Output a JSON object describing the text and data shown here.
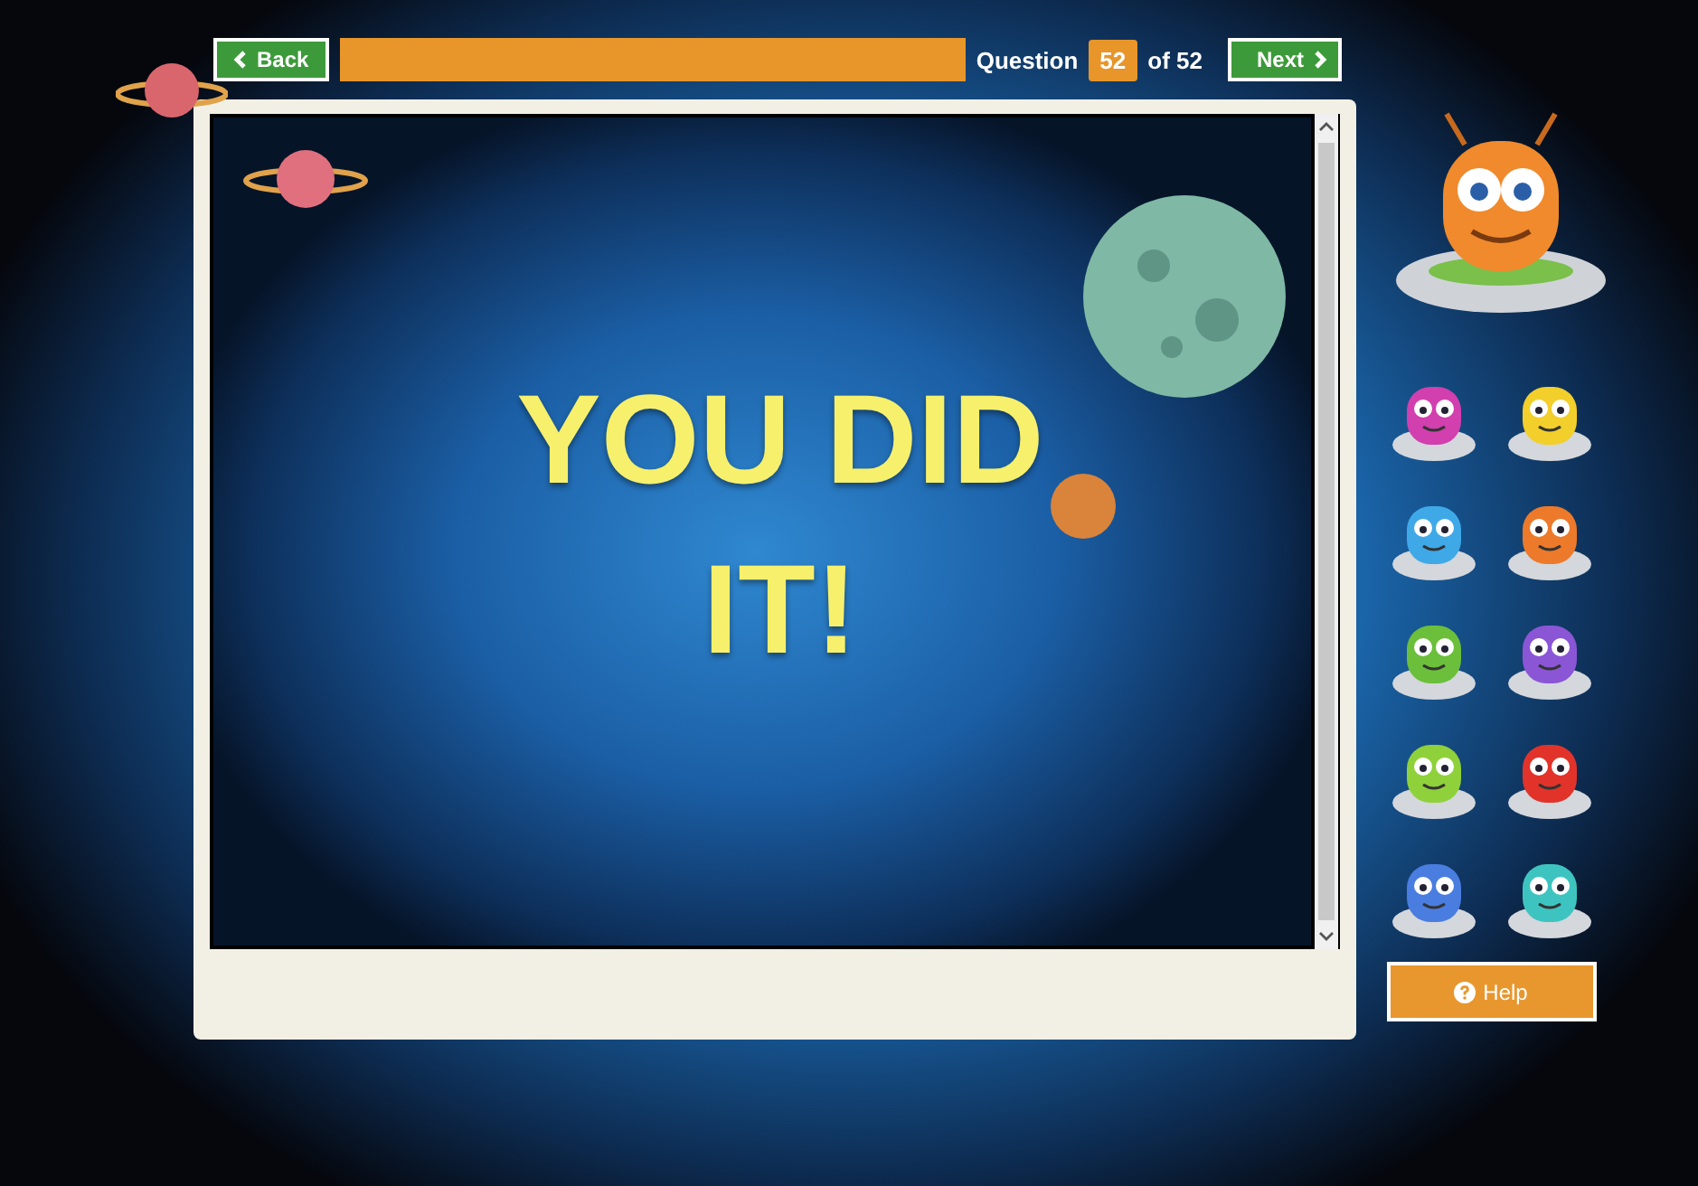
{
  "nav": {
    "back": "Back",
    "progress": {
      "level": 1
    },
    "question_label": "Question",
    "question_number": "52",
    "question_total": "of 52",
    "next": "Next"
  },
  "slide": {
    "message_lines": [
      "YOU DID",
      "IT!"
    ]
  },
  "mascot": {
    "color": "#f08a2c"
  },
  "aliens": [
    {
      "color": "#d23fae"
    },
    {
      "color": "#f2cf2a"
    },
    {
      "color": "#3fa9e8"
    },
    {
      "color": "#ec7a2a"
    },
    {
      "color": "#6bbf3a"
    },
    {
      "color": "#8a56d6"
    },
    {
      "color": "#8fd13a"
    },
    {
      "color": "#e2332a"
    },
    {
      "color": "#4a7de0"
    },
    {
      "color": "#3ec4c0"
    }
  ],
  "help": "Help"
}
